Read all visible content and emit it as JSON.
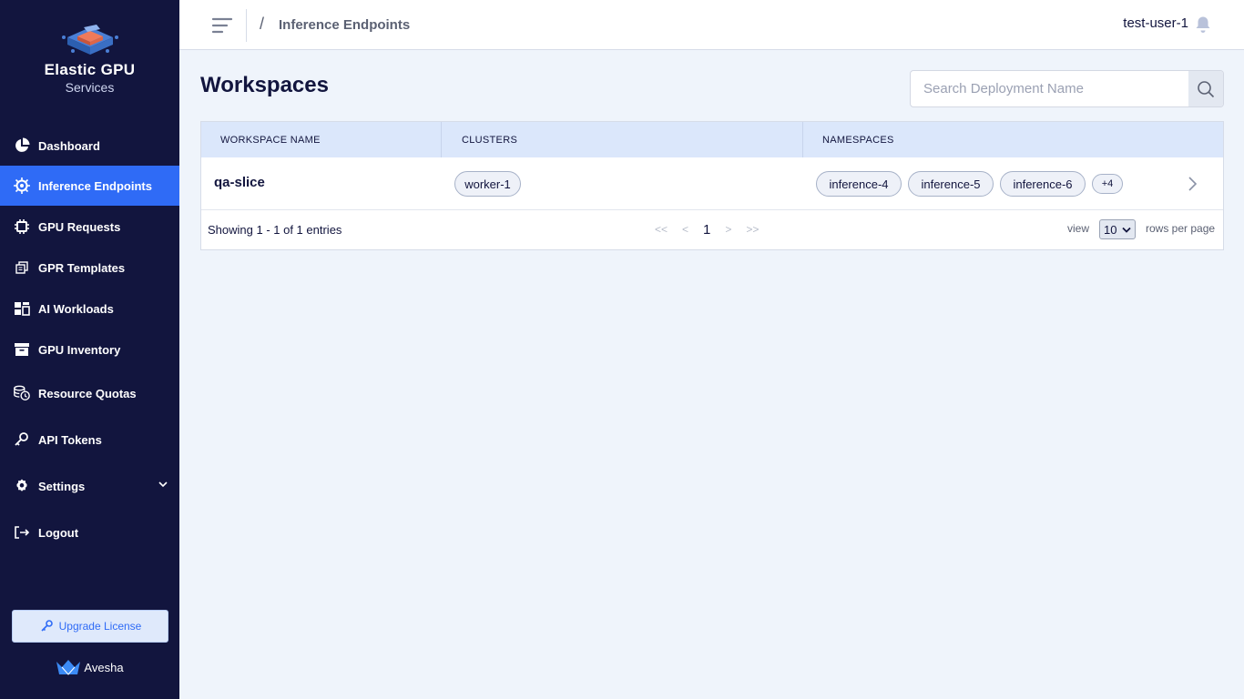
{
  "sidebar": {
    "brand_title": "Elastic GPU",
    "brand_subtitle": "Services",
    "items": [
      {
        "label": "Dashboard",
        "icon": "pie-chart-icon"
      },
      {
        "label": "Inference Endpoints",
        "icon": "chip-gear-icon",
        "active": true
      },
      {
        "label": "GPU Requests",
        "icon": "chip-icon"
      },
      {
        "label": "GPR Templates",
        "icon": "copy-icon"
      },
      {
        "label": "AI Workloads",
        "icon": "grid-icon"
      },
      {
        "label": "GPU Inventory",
        "icon": "archive-icon"
      },
      {
        "label": "Resource Quotas",
        "icon": "coins-clock-icon"
      },
      {
        "label": "API Tokens",
        "icon": "key-icon"
      },
      {
        "label": "Settings",
        "icon": "gear-icon"
      },
      {
        "label": "Logout",
        "icon": "logout-icon"
      }
    ],
    "upgrade_label": "Upgrade License",
    "footer_brand": "Avesha"
  },
  "header": {
    "breadcrumb_sep": "/",
    "breadcrumb": "Inference Endpoints",
    "user": "test-user-1"
  },
  "main": {
    "title": "Workspaces",
    "search_placeholder": "Search Deployment Name",
    "table": {
      "columns": [
        "WORKSPACE NAME",
        "CLUSTERS",
        "NAMESPACES"
      ],
      "rows": [
        {
          "workspace": "qa-slice",
          "clusters": [
            "worker-1"
          ],
          "namespaces": [
            "inference-4",
            "inference-5",
            "inference-6"
          ],
          "more": "+4"
        }
      ]
    },
    "footer": {
      "showing": "Showing 1 - 1 of 1 entries",
      "first": "<<",
      "prev": "<",
      "page": "1",
      "next": ">",
      "last": ">>",
      "view_label": "view",
      "rows_per_page": "10",
      "rows_label": "rows per page"
    }
  },
  "colors": {
    "sidebar_bg": "#12153e",
    "accent": "#2f6bf6",
    "page_bg": "#eff4fb",
    "table_header_bg": "#dbe7fb"
  }
}
